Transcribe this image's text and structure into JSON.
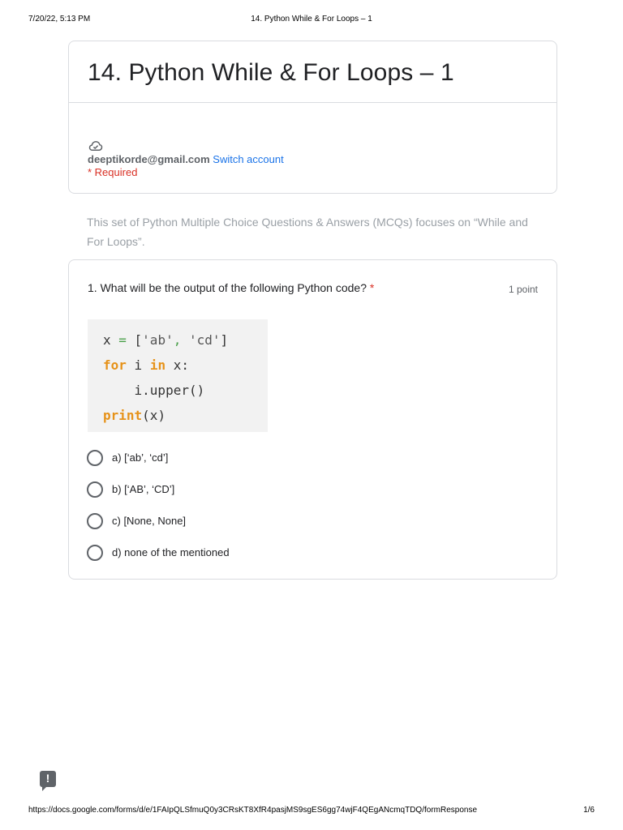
{
  "print_header": {
    "date": "7/20/22, 5:13 PM",
    "doc_title": "14. Python While & For Loops – 1"
  },
  "form": {
    "title": "14. Python While & For Loops – 1",
    "account_email": "deeptikorde@gmail.com",
    "switch_account_label": "Switch account",
    "cloud_icon": "cloud-saved-icon",
    "required_note": "* Required"
  },
  "description": "This set of Python Multiple Choice Questions & Answers (MCQs) focuses on “While and For Loops”.",
  "question": {
    "title": "1. What will be the output of the following Python code?",
    "required_mark": "*",
    "points": "1 point",
    "code": {
      "line1_var": "x ",
      "line1_eq": "=",
      "line1_open": " [",
      "line1_s1": "'ab'",
      "line1_comma": ",",
      "line1_s2": " 'cd'",
      "line1_close": "]",
      "line2_for": "for",
      "line2_mid": " i ",
      "line2_in": "in",
      "line2_end": " x:",
      "line3": "    i.upper()",
      "line4_print": "print",
      "line4_args": "(x)"
    },
    "options": [
      "a) [‘ab’, ‘cd’]",
      "b) [‘AB’, ‘CD’]",
      "c) [None, None]",
      "d) none of the mentioned"
    ]
  },
  "feedback_icon_glyph": "!",
  "print_footer": {
    "url": "https://docs.google.com/forms/d/e/1FAIpQLSfmuQ0y3CRsKT8XfR4pasjMS9sgES6gg74wjF4QEgANcmqTDQ/formResponse",
    "page": "1/6"
  },
  "colors": {
    "required": "#d93025",
    "link": "#1a73e8",
    "keyword": "#e69219"
  }
}
